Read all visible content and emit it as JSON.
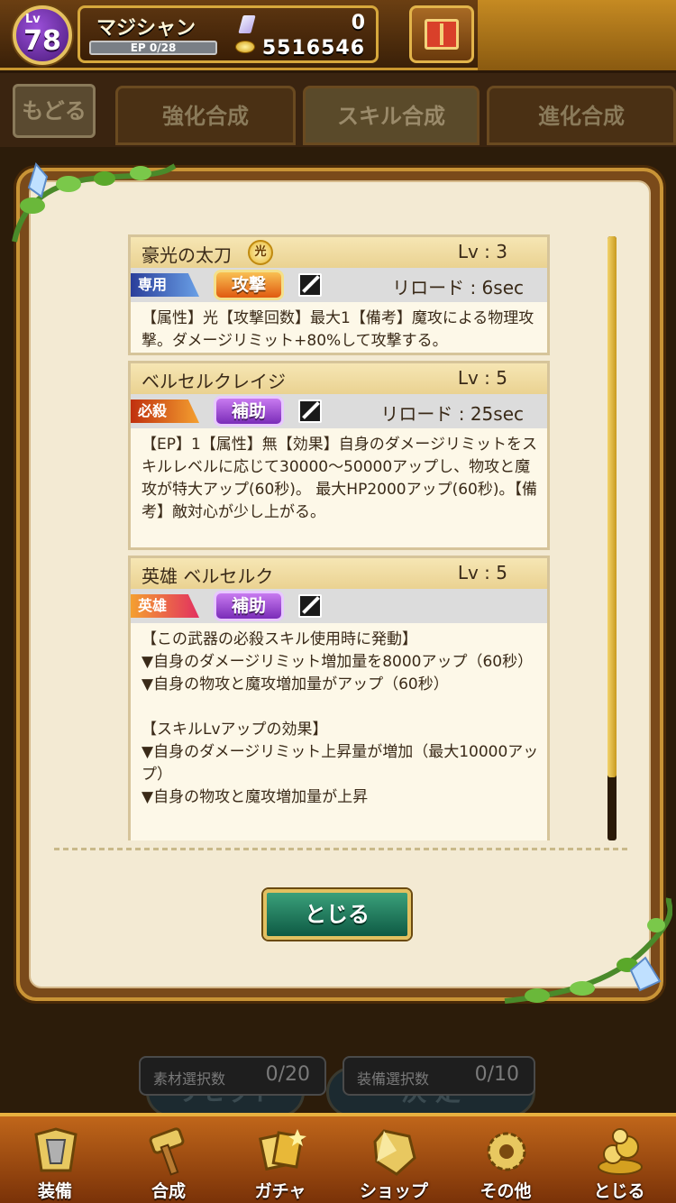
{
  "player": {
    "level_label": "Lv",
    "level": "78",
    "name": "マジシャン",
    "ep": "EP 0/28",
    "gems": "0",
    "coins": "5516546"
  },
  "background": {
    "back_label": "もどる",
    "tabs": [
      "強化合成",
      "スキル合成",
      "進化合成"
    ],
    "reset_label": "リセット",
    "confirm_label": "決 定",
    "material_counter": {
      "label": "素材選択数",
      "value": "0/20"
    },
    "equipment_counter": {
      "label": "装備選択数",
      "value": "0/10"
    }
  },
  "skills": [
    {
      "name": "豪光の太刀",
      "attribute_badge": "光",
      "level": "Lv : 3",
      "ribbon": "専用",
      "type": "攻撃",
      "reload": "リロード : 6sec",
      "description": "【属性】光【攻撃回数】最大1【備考】魔攻による物理攻撃。ダメージリミット+80%して攻撃する。"
    },
    {
      "name": "ベルセルクレイジ",
      "level": "Lv : 5",
      "ribbon": "必殺",
      "type": "補助",
      "reload": "リロード : 25sec",
      "description": "【EP】1【属性】無【効果】自身のダメージリミットをスキルレベルに応じて30000〜50000アップし、物攻と魔攻が特大アップ(60秒)。 最大HP2000アップ(60秒)。【備考】敵対心が少し上がる。"
    },
    {
      "name": "英雄 ベルセルク",
      "level": "Lv : 5",
      "ribbon": "英雄",
      "type": "補助",
      "description": "【この武器の必殺スキル使用時に発動】\n▼自身のダメージリミット増加量を8000アップ（60秒）\n▼自身の物攻と魔攻増加量がアップ（60秒）\n\n【スキルLvアップの効果】\n▼自身のダメージリミット上昇量が増加（最大10000アップ）\n▼自身の物攻と魔攻増加量が上昇"
    }
  ],
  "modal": {
    "close_label": "とじる"
  },
  "nav": [
    {
      "label": "装備",
      "icon": "armor-icon"
    },
    {
      "label": "合成",
      "icon": "hammer-icon"
    },
    {
      "label": "ガチャ",
      "icon": "gacha-icon"
    },
    {
      "label": "ショップ",
      "icon": "crystal-icon"
    },
    {
      "label": "その他",
      "icon": "gear-icon"
    },
    {
      "label": "とじる",
      "icon": "gold-pile-icon"
    }
  ],
  "colors": {
    "accent_gold": "#c99436",
    "button_green": "#0e5a44",
    "panel_cream": "#f3ead3"
  }
}
